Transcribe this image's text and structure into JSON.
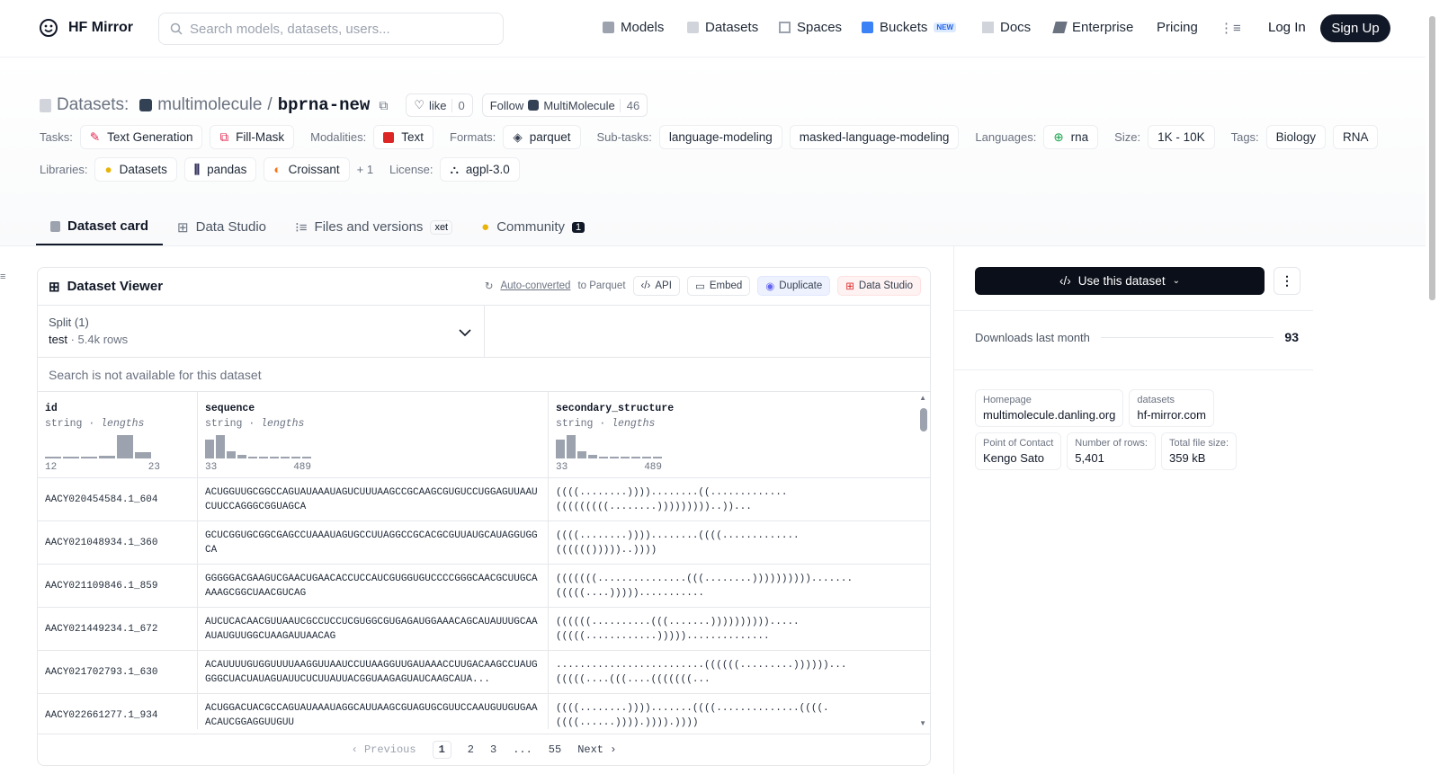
{
  "brand": {
    "name": "HF Mirror"
  },
  "search": {
    "placeholder": "Search models, datasets, users..."
  },
  "nav": {
    "models": "Models",
    "datasets": "Datasets",
    "spaces": "Spaces",
    "buckets": "Buckets",
    "buckets_badge": "NEW",
    "docs": "Docs",
    "enterprise": "Enterprise",
    "pricing": "Pricing",
    "login": "Log In",
    "signup": "Sign Up"
  },
  "dataset": {
    "prefix": "Datasets:",
    "owner": "multimolecule",
    "slash": "/",
    "name": "bprna-new",
    "like_label": "like",
    "like_count": "0",
    "follow_label": "Follow",
    "follow_org": "MultiMolecule",
    "follow_count": "46"
  },
  "tags": {
    "tasks_label": "Tasks:",
    "tasks": [
      "Text Generation",
      "Fill-Mask"
    ],
    "modalities_label": "Modalities:",
    "modalities": [
      "Text"
    ],
    "formats_label": "Formats:",
    "formats": [
      "parquet"
    ],
    "subtasks_label": "Sub-tasks:",
    "subtasks": [
      "language-modeling",
      "masked-language-modeling"
    ],
    "languages_label": "Languages:",
    "languages": [
      "rna"
    ],
    "size_label": "Size:",
    "size": [
      "1K - 10K"
    ],
    "tags_label": "Tags:",
    "tags": [
      "Biology",
      "RNA"
    ],
    "libraries_label": "Libraries:",
    "libraries": [
      "Datasets",
      "pandas",
      "Croissant"
    ],
    "libraries_more": "+ 1",
    "license_label": "License:",
    "license": "agpl-3.0"
  },
  "tabs": {
    "card": "Dataset card",
    "studio": "Data Studio",
    "files": "Files and versions",
    "files_badge": "xet",
    "community": "Community",
    "community_count": "1"
  },
  "viewer": {
    "title": "Dataset Viewer",
    "auto_converted": "Auto-converted",
    "to_parquet": "to Parquet",
    "api": "API",
    "embed": "Embed",
    "duplicate": "Duplicate",
    "data_studio": "Data Studio",
    "split_label": "Split (1)",
    "split_name": "test",
    "split_rows": "5.4k rows",
    "search_note": "Search is not available for this dataset",
    "columns": [
      {
        "name": "id",
        "type": "string",
        "stat": "lengths",
        "min": "12",
        "max": "23"
      },
      {
        "name": "sequence",
        "type": "string",
        "stat": "lengths",
        "min": "33",
        "max": "489"
      },
      {
        "name": "secondary_structure",
        "type": "string",
        "stat": "lengths",
        "min": "33",
        "max": "489"
      }
    ],
    "rows": [
      {
        "id": "AACY020454584.1_604",
        "seq": "ACUGGUUGCGGCCAGUAUAAAUAGUCUUUAAGCCGCAAGCGUGUCCUGGAGUUAAUCUUCCAGGGCGGUAGCA",
        "ss": "((((........))))........((.............\n(((((((((........)))))))))..))..."
      },
      {
        "id": "AACY021048934.1_360",
        "seq": "GCUCGGUGCGGCGAGCCUAAAUAGUGCCUUAGGCCGCACGCGUUAUGCAUAGGUGGCA",
        "ss": "((((........))))........((((.............\n(((((()))))..))))"
      },
      {
        "id": "AACY021109846.1_859",
        "seq": "GGGGGACGAAGUCGAACUGAACACCUCCAUCGUGGUGUCCCCGGGCAACGCUUGCAAAAGCGGCUAACGUCAG",
        "ss": "(((((((...............(((........)))))))))).......\n(((((....)))))..........."
      },
      {
        "id": "AACY021449234.1_672",
        "seq": "AUCUCACAACGUUAAUCGCCUCCUCGUGGCGUGAGAUGGAAACAGCAUAUUUGCAAAUAUGUUGGCUAAGAUUAACAG",
        "ss": "((((((..........(((.......)))))))))).....\n(((((............))))).............."
      },
      {
        "id": "AACY021702793.1_630",
        "seq": "ACAUUUUGUGGUUUUAAGGUUAAUCCUUAAGGUUGAUAAACCUUGACAAGCCUAUGGGGCUACUAUAGUAUUCUCUUAUUACGGUAAGAGUAUCAAGCAUA...",
        "ss": ".........................((((((.........))))))...\n(((((....(((....(((((((..."
      },
      {
        "id": "AACY022661277.1_934",
        "seq": "ACUGGACUACGCCAGUAUAAAUAGGCAUUAAGCGUAGUGCGUUCCAAUGUUGUGAAACAUCGGAGGUUGUU",
        "ss": "((((........)))).......((((..............((((.\n((((......)))).)))).))))"
      }
    ],
    "pages": [
      "1",
      "2",
      "3",
      "...",
      "55"
    ],
    "prev": "Previous",
    "next": "Next"
  },
  "sidebar": {
    "use_dataset": "Use this dataset",
    "downloads_label": "Downloads last month",
    "downloads_value": "93",
    "meta": [
      {
        "label": "Homepage",
        "value": "multimolecule.danling.org"
      },
      {
        "label": "datasets",
        "value": "hf-mirror.com"
      },
      {
        "label": "Point of Contact",
        "value": "Kengo Sato"
      },
      {
        "label": "Number of rows:",
        "value": "5,401"
      },
      {
        "label": "Total file size:",
        "value": "359 kB"
      }
    ]
  },
  "histograms": {
    "id": [
      0.05,
      0.05,
      0.05,
      0.1,
      1.0,
      0.25
    ],
    "sequence": [
      0.8,
      1.0,
      0.3,
      0.15,
      0.08,
      0.05,
      0.05,
      0.05,
      0.05,
      0.05
    ],
    "secondary_structure": [
      0.8,
      1.0,
      0.3,
      0.15,
      0.08,
      0.05,
      0.05,
      0.05,
      0.05,
      0.05
    ]
  }
}
